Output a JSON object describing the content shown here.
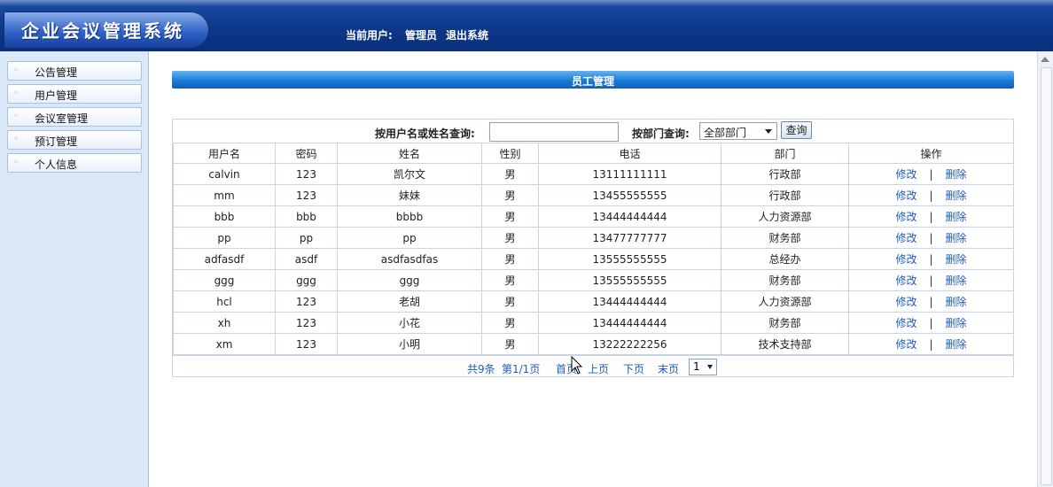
{
  "header": {
    "logo_text": "企业会议管理系统",
    "current_user_label": "当前用户:",
    "user_name": "管理员",
    "logout": "退出系统"
  },
  "sidebar": {
    "items": [
      {
        "label": "公告管理"
      },
      {
        "label": "用户管理"
      },
      {
        "label": "会议室管理"
      },
      {
        "label": "预订管理"
      },
      {
        "label": "个人信息"
      }
    ]
  },
  "main": {
    "title": "员工管理",
    "search": {
      "by_name_label": "按用户名或姓名查询:",
      "by_name_value": "",
      "by_dept_label": "按部门查询:",
      "dept_selected": "全部部门",
      "query_button": "查询"
    },
    "table": {
      "headers": [
        "用户名",
        "密码",
        "姓名",
        "性别",
        "电话",
        "部门",
        "操作"
      ],
      "edit_label": "修改",
      "delete_label": "删除",
      "rows": [
        {
          "username": "calvin",
          "password": "123",
          "name": "凯尔文",
          "gender": "男",
          "phone": "13111111111",
          "dept": "行政部"
        },
        {
          "username": "mm",
          "password": "123",
          "name": "妹妹",
          "gender": "男",
          "phone": "13455555555",
          "dept": "行政部"
        },
        {
          "username": "bbb",
          "password": "bbb",
          "name": "bbbb",
          "gender": "男",
          "phone": "13444444444",
          "dept": "人力资源部"
        },
        {
          "username": "pp",
          "password": "pp",
          "name": "pp",
          "gender": "男",
          "phone": "13477777777",
          "dept": "财务部"
        },
        {
          "username": "adfasdf",
          "password": "asdf",
          "name": "asdfasdfas",
          "gender": "男",
          "phone": "13555555555",
          "dept": "总经办"
        },
        {
          "username": "ggg",
          "password": "ggg",
          "name": "ggg",
          "gender": "男",
          "phone": "13555555555",
          "dept": "财务部"
        },
        {
          "username": "hcl",
          "password": "123",
          "name": "老胡",
          "gender": "男",
          "phone": "13444444444",
          "dept": "人力资源部"
        },
        {
          "username": "xh",
          "password": "123",
          "name": "小花",
          "gender": "男",
          "phone": "13444444444",
          "dept": "财务部"
        },
        {
          "username": "xm",
          "password": "123",
          "name": "小明",
          "gender": "男",
          "phone": "13222222256",
          "dept": "技术支持部"
        }
      ]
    },
    "pager": {
      "total": "共9条",
      "page_info": "第1/1页",
      "first": "首页",
      "prev": "上页",
      "next": "下页",
      "last": "末页",
      "page_selected": "1"
    }
  },
  "colors": {
    "header_bg": "#0f3a8e",
    "title_bar": "#1a7bd6",
    "link": "#1d5bbf",
    "sidebar_bg": "#dbe8f8"
  }
}
